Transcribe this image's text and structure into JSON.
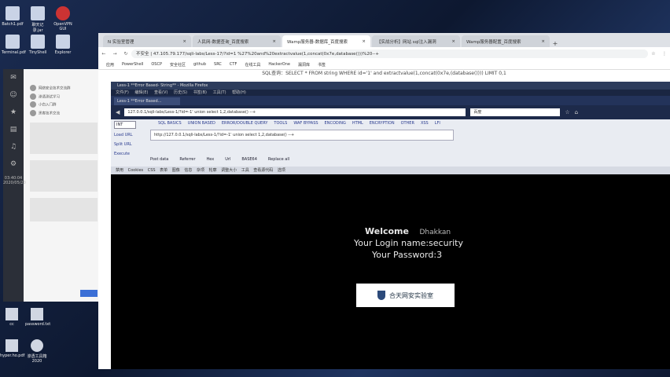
{
  "desktop": {
    "icons_top": [
      "Batch1.pdf",
      "聊天记录.jar",
      "OpenVPN GUI",
      "Terminal.pdf",
      "TinyShell",
      "Explorer"
    ],
    "icons_bottom": [
      "cc",
      "password.txt",
      "hyper.ho.pdf",
      "渗透工具箱 2020"
    ]
  },
  "qq": {
    "nav": [
      "消息",
      "联系人",
      "收藏",
      "文件",
      "设置"
    ],
    "items": [
      "网络安全技术交流群",
      "渗透测试学习",
      "小白入门群",
      "黑客技术交流"
    ],
    "time": "03:40:04",
    "date": "2020/05/20"
  },
  "chrome": {
    "tabs": [
      {
        "label": "N 实验室管理"
      },
      {
        "label": "人民网-数据查询_百度搜索"
      },
      {
        "label": "Wamp服务器-数据库_百度搜索"
      },
      {
        "label": "【实战分析】网站 sql注入漏洞"
      },
      {
        "label": "Wamp服务器配置_百度搜索"
      }
    ],
    "url": "不安全 | 47.105.79.177/sqli-labs/Less-17/?id=1 %27%20and%20extractvalue(1,concat(0x7e,database()))%20--+",
    "bookmarks": [
      "应用",
      "PowerShell",
      "OSCP",
      "安全社区",
      "github",
      "SRC",
      "CTF",
      "在线工具",
      "HackerOne",
      "漏洞库",
      "书签"
    ],
    "sql_title": "SQL查询：SELECT * FROM string WHERE id='1' and extractvalue(1,concat(0x7e,(database()))) LIMIT 0,1"
  },
  "firefox": {
    "title": "Less-1 **Error Based- String** - Mozilla Firefox",
    "menu": [
      "文件(F)",
      "编辑(E)",
      "查看(V)",
      "历史(S)",
      "书签(B)",
      "工具(T)",
      "帮助(H)"
    ],
    "tab": "Less-1 **Error Based...",
    "url": "127.0.0.1/sqli-labs/Less-1/?id=-1' union select 1,2,database() --+",
    "search": "百度",
    "hackbar": {
      "dropdown": "INT",
      "menu": [
        "SQL BASICS",
        "UNION BASED",
        "ERROR/DOUBLE QUERY",
        "TOOLS",
        "WAF BYPASS",
        "ENCODING",
        "HTML",
        "ENCRYPTION",
        "OTHER",
        "XSS",
        "LFI"
      ],
      "side": [
        "Load URL",
        "Split URL",
        "Execute"
      ],
      "url": "http://127.0.0.1/sqli-labs/Less-1/?id=-1' union select 1,2,database() --+",
      "options": [
        "Post data",
        "Referrer",
        "Hex",
        "Url",
        "BASE64",
        "Replace all"
      ]
    },
    "subnav": "禁用 Cookies CSS 表单 图像 信息 杂项 轮廓 调整大小 工具 查看源代码 选项"
  },
  "page": {
    "welcome": "Welcome",
    "name": "Dhakkan",
    "login": "Your Login name:security",
    "password": "Your Password:3",
    "logo_text": "合天网安实验室"
  }
}
